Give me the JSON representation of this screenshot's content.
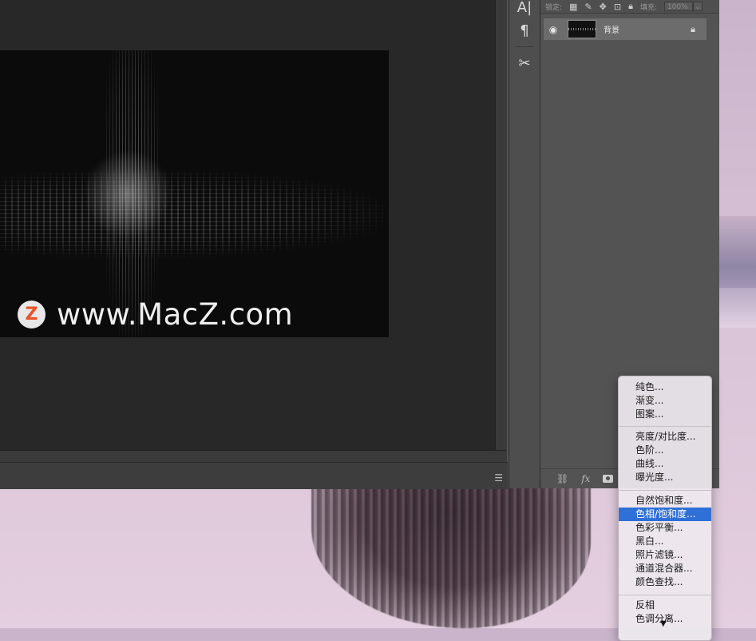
{
  "canvas": {
    "watermark_logo_letter": "Z",
    "watermark_text": "www.MacZ.com"
  },
  "tools": {
    "text_tool_glyph": "A|",
    "paragraph_glyph": "¶",
    "tool3_glyph": "✂"
  },
  "layers_panel": {
    "lock_label": "锁定:",
    "fill_label": "填充:",
    "fill_value": "100%",
    "layers": [
      {
        "name": "背景",
        "visible": true,
        "locked": true
      }
    ],
    "footer_icons": [
      "link-icon",
      "fx-icon",
      "mask-icon"
    ],
    "fx_label": "fx"
  },
  "adjustment_menu": {
    "groups": [
      [
        "纯色...",
        "渐变...",
        "图案..."
      ],
      [
        "亮度/对比度...",
        "色阶...",
        "曲线...",
        "曝光度..."
      ],
      [
        "自然饱和度...",
        "色相/饱和度...",
        "色彩平衡...",
        "黑白...",
        "照片滤镜...",
        "通道混合器...",
        "颜色查找..."
      ],
      [
        "反相",
        "色调分离..."
      ]
    ],
    "selected": "色相/饱和度...",
    "more_indicator": "▼"
  },
  "colors": {
    "ps_panel": "#535353",
    "doc_bg": "#282828",
    "menu_highlight": "#2f6fd8",
    "watermark_logo": "#e9532a"
  }
}
